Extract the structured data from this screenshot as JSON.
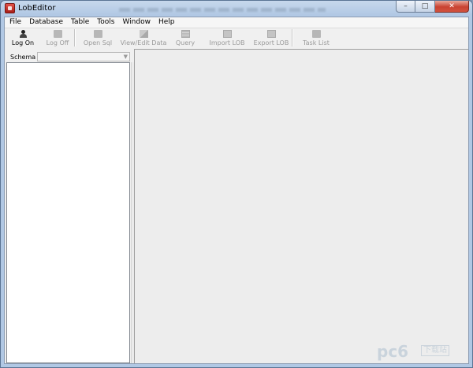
{
  "window": {
    "title": "LobEditor",
    "min_glyph": "–",
    "max_glyph": "□",
    "close_glyph": "✕"
  },
  "menubar": {
    "items": [
      "File",
      "Database",
      "Table",
      "Tools",
      "Window",
      "Help"
    ]
  },
  "toolbar": {
    "buttons": [
      {
        "label": "Log On",
        "icon": "user-icon",
        "enabled": true
      },
      {
        "label": "Log Off",
        "icon": "user-off-icon",
        "enabled": false
      },
      {
        "label": "Open Sql",
        "icon": "folder-icon",
        "enabled": false
      },
      {
        "label": "View/Edit Data",
        "icon": "edit-icon",
        "enabled": false
      },
      {
        "label": "Query",
        "icon": "query-icon",
        "enabled": false
      },
      {
        "label": "Import LOB",
        "icon": "import-icon",
        "enabled": false
      },
      {
        "label": "Export LOB",
        "icon": "export-icon",
        "enabled": false
      },
      {
        "label": "Task List",
        "icon": "task-list-icon",
        "enabled": false
      }
    ]
  },
  "schema": {
    "label": "Schema",
    "value": ""
  },
  "watermark": {
    "brand": "pc6",
    "site": "下载站"
  },
  "colors": {
    "close_button": "#c94231",
    "disabled_text": "#9a9a9a",
    "frame": "#b1c8e4"
  }
}
